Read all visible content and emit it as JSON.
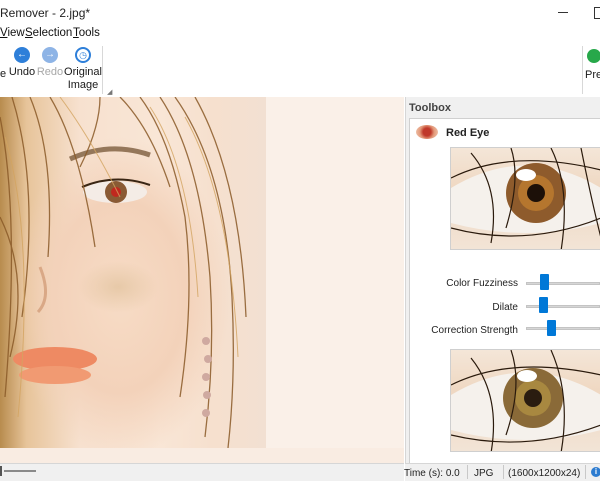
{
  "window": {
    "title": "Remover - 2.jpg*"
  },
  "menu": {
    "items": [
      {
        "label": "View",
        "underline": "V",
        "rest": "iew"
      },
      {
        "label": "Selection",
        "underline": "S",
        "rest": "election"
      },
      {
        "label": "Tools",
        "underline": "T",
        "rest": "ools"
      }
    ]
  },
  "ribbon": {
    "partial_left": "e",
    "undo": {
      "label": "Undo",
      "icon": "undo-arrow-icon"
    },
    "redo": {
      "label": "Redo",
      "icon": "redo-arrow-icon"
    },
    "original_image": {
      "line1": "Original",
      "line2": "Image",
      "icon": "history-icon"
    },
    "preview_partial": "Pre"
  },
  "toolbox": {
    "title": "Toolbox",
    "tool_name": "Red Eye",
    "sliders": [
      {
        "label": "Color Fuzziness",
        "fraction": 0.28
      },
      {
        "label": "Dilate",
        "fraction": 0.26
      },
      {
        "label": "Correction Strength",
        "fraction": 0.38
      }
    ]
  },
  "statusbar": {
    "time": "Time (s): 0.0",
    "format": "JPG",
    "dimensions": "(1600x1200x24)"
  },
  "colors": {
    "accent": "#0078d7",
    "preview_green": "#27a84a"
  }
}
